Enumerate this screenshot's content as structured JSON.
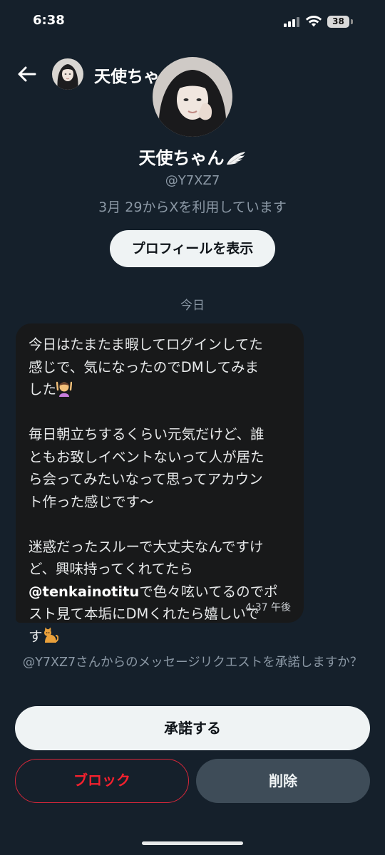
{
  "status_bar": {
    "time": "6:38",
    "battery": "38"
  },
  "header": {
    "name": "天使ちゃん",
    "name_emoji": "wing-icon"
  },
  "profile": {
    "name": "天使ちゃん",
    "handle": "@Y7XZ7",
    "joined": "3月 29からXを利用しています",
    "view_profile_label": "プロフィールを表示"
  },
  "date_separator": "今日",
  "message": {
    "lines": [
      "今日はたまたま暇してログインしてた",
      "感じで、気になったのでDMしてみま",
      "した",
      "",
      "毎日朝立ちするくらい元気だけど、誰",
      "ともお致しイベントないって人が居た",
      "ら会ってみたいなって思ってアカウン",
      "ト作った感じです〜",
      "",
      "迷惑だったスルーで大丈夫なんですけ",
      "ど、興味持ってくれてたら",
      "@tenkainotitu",
      "で色々呟いてるのでポ",
      "スト見て本垢にDMくれたら嬉しいで",
      "す"
    ],
    "time": "4:37 午後",
    "emoji_1": "🙆‍♀️",
    "emoji_2": "🐈"
  },
  "request": {
    "text": "@Y7XZ7さんからのメッセージリクエストを承諾しますか？"
  },
  "buttons": {
    "accept": "承諾する",
    "block": "ブロック",
    "delete": "削除"
  },
  "colors": {
    "background": "#15202b",
    "bubble": "#18191a",
    "danger": "#f4212e",
    "secondary_text": "#8b98a5"
  }
}
